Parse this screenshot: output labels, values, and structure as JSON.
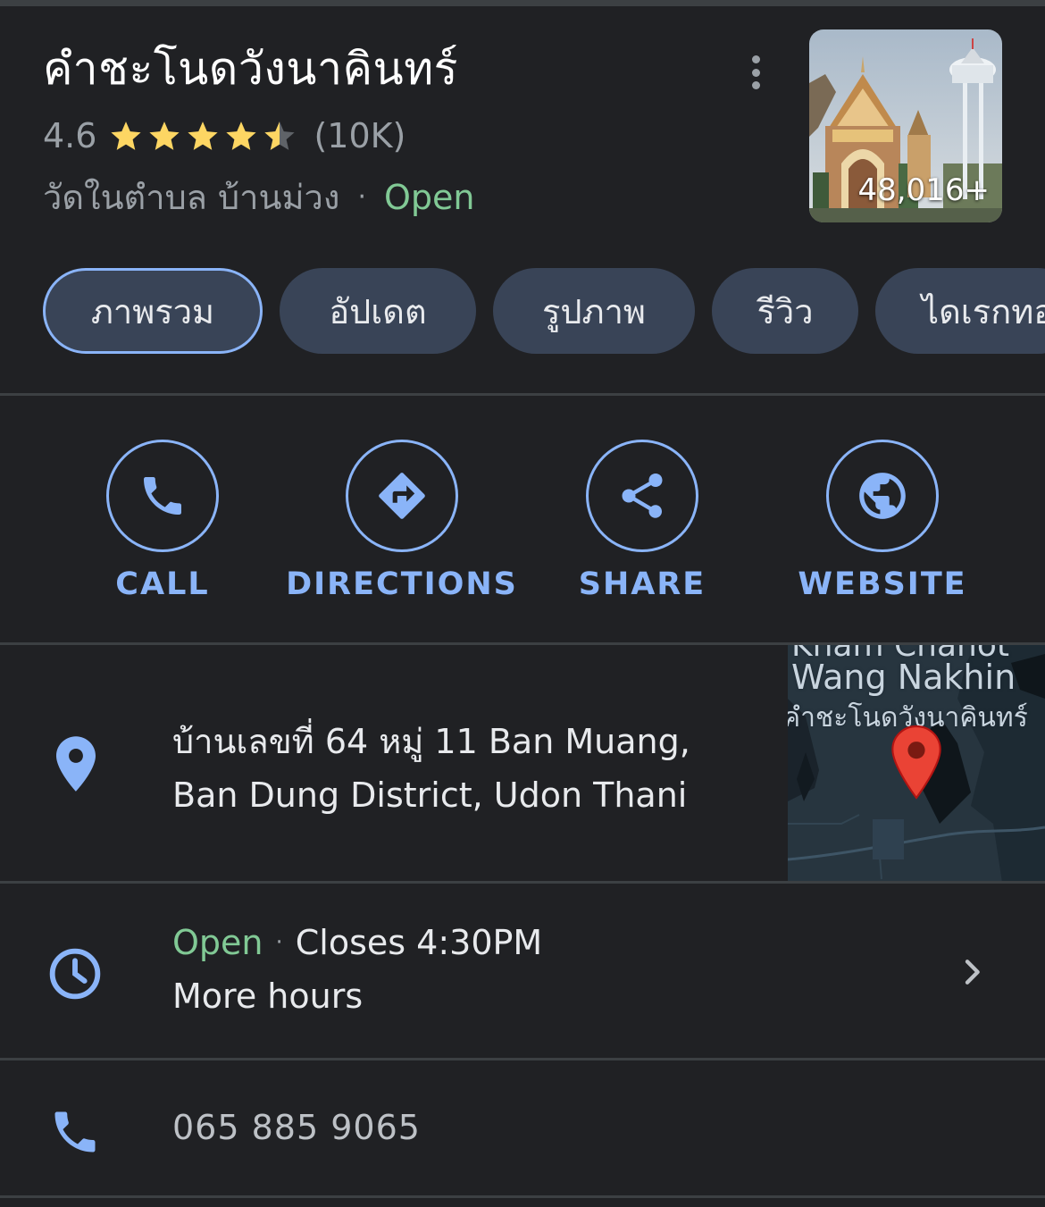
{
  "place": {
    "name": "คำชะโนดวังนาคินทร์",
    "rating": "4.6",
    "rating_stars": 4.6,
    "review_count": "(10K)",
    "category": "วัดในตำบล บ้านม่วง",
    "separator": "·",
    "status": "Open",
    "photo_count": "48,016+"
  },
  "tabs": [
    {
      "label": "ภาพรวม",
      "active": true
    },
    {
      "label": "อัปเดต",
      "active": false
    },
    {
      "label": "รูปภาพ",
      "active": false
    },
    {
      "label": "รีวิว",
      "active": false
    },
    {
      "label": "ไดเรกทอ",
      "active": false
    }
  ],
  "actions": [
    {
      "label": "CALL",
      "icon": "phone-icon"
    },
    {
      "label": "DIRECTIONS",
      "icon": "directions-icon"
    },
    {
      "label": "SHARE",
      "icon": "share-icon"
    },
    {
      "label": "WEBSITE",
      "icon": "globe-icon"
    }
  ],
  "address": {
    "line1": "บ้านเลขที่ 64 หมู่ 11 Ban Muang,",
    "line2": "Ban Dung District, Udon Thani",
    "icon": "location-pin-icon"
  },
  "map": {
    "label_top": "Kham Chanot",
    "label_mid": "Wang Nakhin",
    "label_thai": "คำชะโนดวังนาคินทร์"
  },
  "hours": {
    "status": "Open",
    "separator": "·",
    "closes": "Closes 4:30PM",
    "more": "More hours",
    "icon": "clock-icon"
  },
  "phone": {
    "number": "065 885 9065",
    "icon": "phone-icon"
  },
  "colors": {
    "background": "#202124",
    "accent": "#8ab4f8",
    "open": "#81c995",
    "chip": "#394457",
    "star": "#fdd663",
    "pin": "#ea4335"
  }
}
